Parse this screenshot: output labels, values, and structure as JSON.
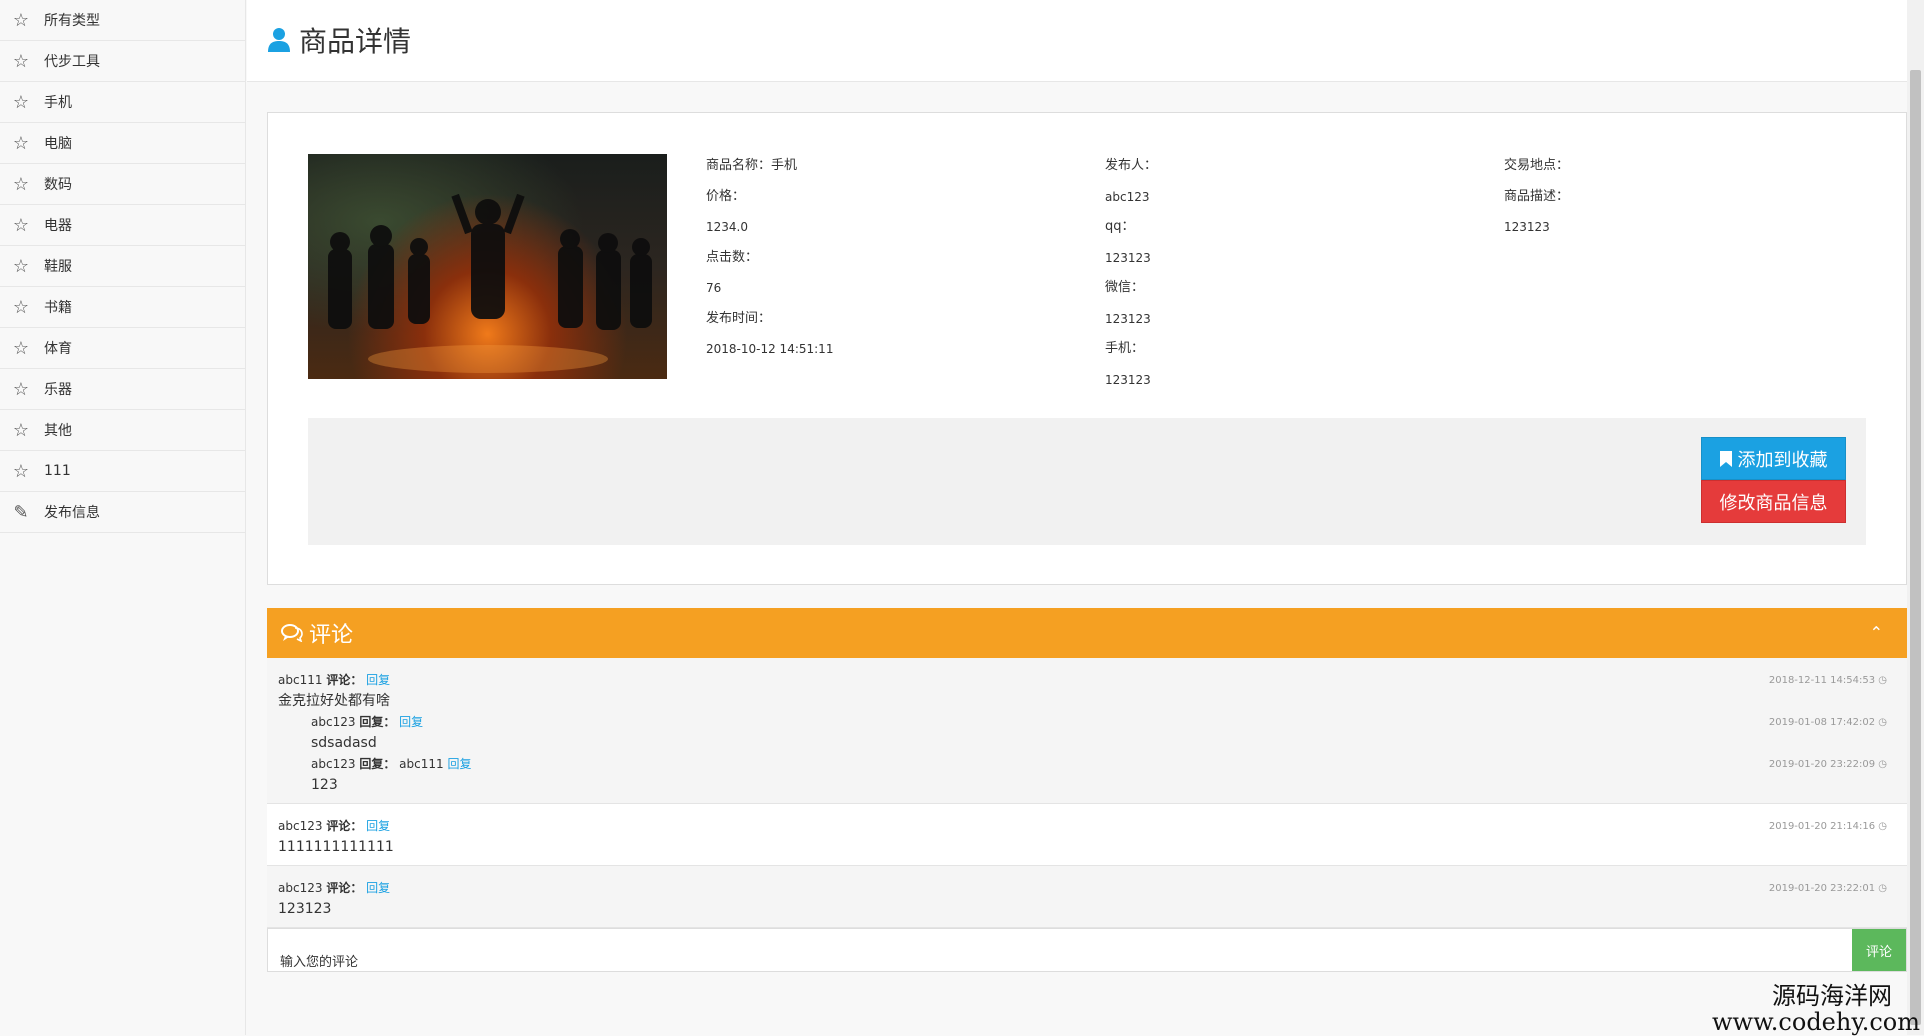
{
  "sidebar": {
    "items": [
      {
        "label": "所有类型",
        "icon": "star-icon"
      },
      {
        "label": "代步工具",
        "icon": "star-icon"
      },
      {
        "label": "手机",
        "icon": "star-icon"
      },
      {
        "label": "电脑",
        "icon": "star-icon"
      },
      {
        "label": "数码",
        "icon": "star-icon"
      },
      {
        "label": "电器",
        "icon": "star-icon"
      },
      {
        "label": "鞋服",
        "icon": "star-icon"
      },
      {
        "label": "书籍",
        "icon": "star-icon"
      },
      {
        "label": "体育",
        "icon": "star-icon"
      },
      {
        "label": "乐器",
        "icon": "star-icon"
      },
      {
        "label": "其他",
        "icon": "star-icon"
      },
      {
        "label": "111",
        "icon": "star-icon"
      },
      {
        "label": "发布信息",
        "icon": "edit-icon"
      }
    ]
  },
  "header": {
    "title": "商品详情",
    "icon": "user-icon",
    "accent": "#1ba1e2"
  },
  "product": {
    "name_label": "商品名称：手机",
    "price_label": "价格：",
    "price_value": "1234.0",
    "clicks_label": "点击数：",
    "clicks_value": "76",
    "time_label": "发布时间：",
    "time_value": "2018-10-12 14:51:11",
    "publisher_label": "发布人：",
    "publisher_value": "abc123",
    "qq_label": "qq：",
    "qq_value": "123123",
    "wechat_label": "微信：",
    "wechat_value": "123123",
    "phone_label": "手机：",
    "phone_value": "123123",
    "location_label": "交易地点：",
    "desc_label": "商品描述：",
    "desc_value": "123123"
  },
  "actions": {
    "favorite_label": "添加到收藏",
    "edit_label": "修改商品信息",
    "favorite_color": "#1ba1e2",
    "edit_color": "#e53b3b"
  },
  "comments": {
    "title": "评论",
    "header_color": "#f5a022",
    "comment_word": "评论：",
    "reply_word": "回复：",
    "reply_link": "回复",
    "threads": [
      {
        "user": "abc111",
        "time": "2018-12-11 14:54:53",
        "text": "金克拉好处都有啥",
        "replies": [
          {
            "user": "abc123",
            "to": "",
            "time": "2019-01-08 17:42:02",
            "text": "sdsadasd"
          },
          {
            "user": "abc123",
            "to": "abc111",
            "time": "2019-01-20 23:22:09",
            "text": "123"
          }
        ]
      },
      {
        "user": "abc123",
        "time": "2019-01-20 21:14:16",
        "text": "1111111111111",
        "replies": []
      },
      {
        "user": "abc123",
        "time": "2019-01-20 23:22:01",
        "text": "123123",
        "replies": []
      }
    ],
    "input_placeholder": "输入您的评论",
    "submit_label": "评论",
    "submit_color": "#5cb85c"
  },
  "watermark": {
    "line1": "源码海洋网",
    "line2": "www.codehy.com"
  }
}
